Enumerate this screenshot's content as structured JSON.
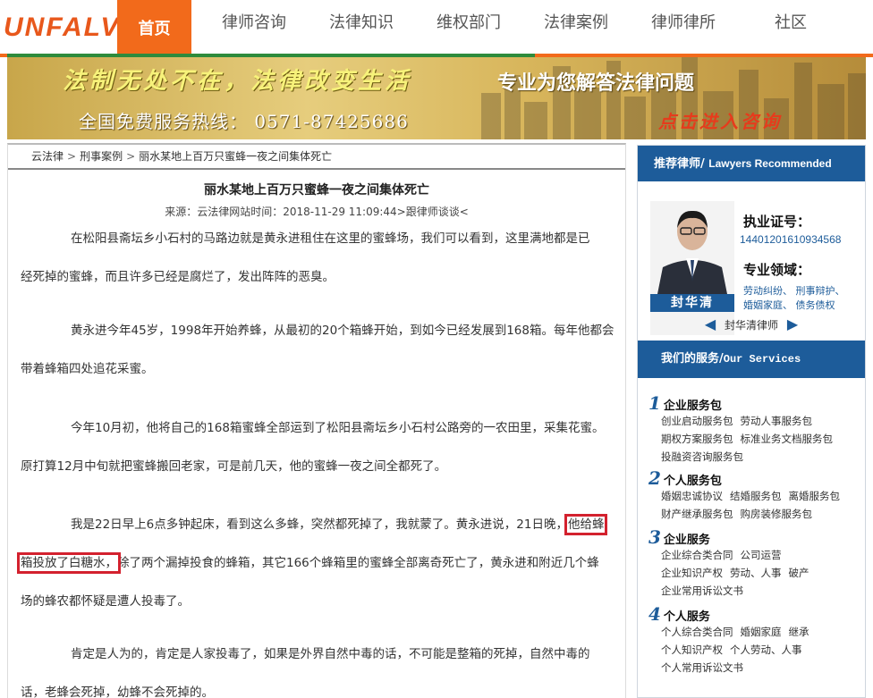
{
  "nav": {
    "logo": "UNFALV",
    "items": [
      "首页",
      "律师咨询",
      "法律知识",
      "维权部门",
      "法律案例",
      "律师律所",
      "社区"
    ]
  },
  "banner": {
    "slogan": "法制无处不在，法律改变生活",
    "tagline": "专业为您解答法律问题",
    "hotline": "全国免费服务热线： 0571-87425686",
    "cta": "点击进入咨询"
  },
  "breadcrumb": [
    "云法律",
    "刑事案例",
    "丽水某地上百万只蜜蜂一夜之间集体死亡"
  ],
  "article": {
    "title": "丽水某地上百万只蜜蜂一夜之间集体死亡",
    "meta": "来源：云法律网站时间：2018-11-29 11:09:44>跟律师谈谈<",
    "paragraphs": [
      {
        "lines": [
          "在松阳县斋坛乡小石村的马路边就是黄永进租住在这里的蜜蜂场，我们可以看到，这里满地都是已",
          "经死掉的蜜蜂，而且许多已经是腐烂了，发出阵阵的恶臭。"
        ]
      },
      {
        "lines": [
          "黄永进今年45岁，1998年开始养蜂，从最初的20个箱蜂开始，到如今已经发展到168箱。每年他都会",
          "带着蜂箱四处追花采蜜。"
        ]
      },
      {
        "lines": [
          "今年10月初，他将自己的168箱蜜蜂全部运到了松阳县斋坛乡小石村公路旁的一农田里，采集花蜜。",
          "原打算12月中旬就把蜜蜂搬回老家，可是前几天，他的蜜蜂一夜之间全都死了。"
        ]
      },
      {
        "line1_pre": "我是22日早上6点多钟起床，看到这么多蜂，突然都死掉了，我就蒙了。黄永进说，21日晚，",
        "line1_hl": "他给蜂",
        "line2_hl": "箱投放了白糖水，",
        "line2_post": "除了两个漏掉投食的蜂箱，其它166个蜂箱里的蜜蜂全部离奇死亡了，黄永进和附近几个蜂",
        "line3": "场的蜂农都怀疑是遭人投毒了。"
      },
      {
        "lines": [
          "肯定是人为的，肯定是人家投毒了，如果是外界自然中毒的话，不可能是整箱的死掉，自然中毒的",
          "话，老蜂会死掉，幼蜂不会死掉的。"
        ]
      }
    ]
  },
  "sidebar": {
    "rec_header_cn": "推荐律师/",
    "rec_header_en": "Lawyers Recommended",
    "lawyer": {
      "name": "封华清",
      "license_label": "执业证号：",
      "license_no": "14401201610934568",
      "field_label": "专业领域：",
      "fields": [
        "劳动纠纷、 刑事辩护、",
        "婚姻家庭、 债务债权"
      ],
      "nav_label": "封华清律师"
    },
    "svc_header_cn": "我们的服务/",
    "svc_header_en": "Our Services",
    "groups": [
      {
        "num": "1",
        "title": "企业服务包",
        "lines": [
          [
            "创业启动服务包",
            "劳动人事服务包"
          ],
          [
            "期权方案服务包",
            "标准业务文档服务包"
          ],
          [
            "投融资咨询服务包"
          ]
        ]
      },
      {
        "num": "2",
        "title": "个人服务包",
        "lines": [
          [
            "婚姻忠诚协议",
            "结婚服务包",
            "离婚服务包"
          ],
          [
            "财产继承服务包",
            "购房装修服务包"
          ]
        ]
      },
      {
        "num": "3",
        "title": "企业服务",
        "lines": [
          [
            "企业综合类合同",
            "公司运营"
          ],
          [
            "企业知识产权",
            "劳动、人事",
            "破产"
          ],
          [
            "企业常用诉讼文书"
          ]
        ]
      },
      {
        "num": "4",
        "title": "个人服务",
        "lines": [
          [
            "个人综合类合同",
            "婚姻家庭",
            "继承"
          ],
          [
            "个人知识产权",
            "个人劳动、人事"
          ],
          [
            "个人常用诉讼文书"
          ]
        ]
      }
    ]
  }
}
